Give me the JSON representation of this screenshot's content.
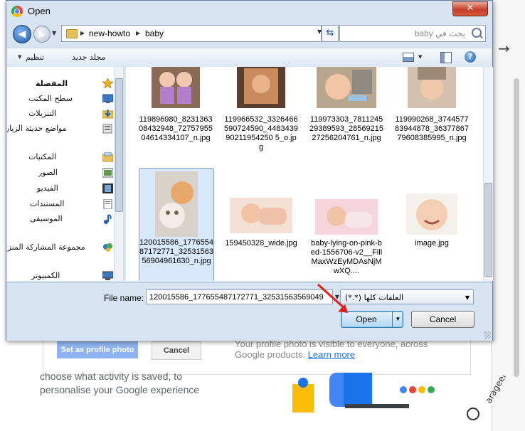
{
  "dialog": {
    "title": "Open",
    "close_label": "✕",
    "breadcrumb": [
      "new-howto",
      "baby"
    ],
    "search_placeholder": "بحث في baby",
    "toolbar": {
      "organize": "تنظيم",
      "new_folder": "مجلد جديد"
    }
  },
  "nav": {
    "items": [
      {
        "label": "المفضلة",
        "icon": "star-icon"
      },
      {
        "label": "سطح المكتب",
        "icon": "desktop-icon"
      },
      {
        "label": "التنزيلات",
        "icon": "downloads-icon"
      },
      {
        "label": "مواضع حديثة الزيارة",
        "icon": "recent-places-icon"
      },
      {
        "label": "المكتبات",
        "icon": "libraries-icon"
      },
      {
        "label": "الصور",
        "icon": "pictures-icon"
      },
      {
        "label": "الفيديو",
        "icon": "videos-icon"
      },
      {
        "label": "المستندات",
        "icon": "documents-icon"
      },
      {
        "label": "الموسيقى",
        "icon": "music-icon"
      },
      {
        "label": "مجموعة المشاركة المنزلية",
        "icon": "homegroup-icon"
      },
      {
        "label": "الكمبيوتر",
        "icon": "computer-icon"
      }
    ]
  },
  "files": [
    {
      "name": "119896980_823136308432948_7275795504614334107_n.jpg",
      "thumb": "twin-babies"
    },
    {
      "name": "119966532_3326466590724590_448343990211954250 5_o.jpg",
      "thumb": "baby-with-hand"
    },
    {
      "name": "119973303_781124529389593_2856921527256204761_n.jpg",
      "thumb": "baby-with-cat"
    },
    {
      "name": "119990268_374457783944878_3637786779608385995_n.jpg",
      "thumb": "baby-with-cat-2"
    },
    {
      "name": "120015586_177655487172771_3253156356904961630_n.jpg",
      "thumb": "kittens",
      "selected": true
    },
    {
      "name": "159450328_wide.jpg",
      "thumb": "baby-lying"
    },
    {
      "name": "baby-lying-on-pink-bed-1556706-v2__FillMaxWzEyMDAsNjMwXQ....",
      "thumb": "baby-pink-bed"
    },
    {
      "name": "image.jpg",
      "thumb": "smiling-baby"
    }
  ],
  "bottom": {
    "file_name_label": "File name:",
    "file_name_value": "120015586_177655487172771_32531563569049",
    "file_type": "العلفات كلها (*.*)",
    "open_label": "Open",
    "cancel_label": "Cancel"
  },
  "background": {
    "set_profile_label": "Set as profile photo",
    "cancel_label": "Cancel",
    "info_text": "Your profile photo is visible to everyone, across Google products.",
    "learn_more": "Learn more",
    "left_text_1": "choose what activity is saved, to",
    "left_text_2": "personalise your Google experience",
    "watermark": "arageek"
  }
}
